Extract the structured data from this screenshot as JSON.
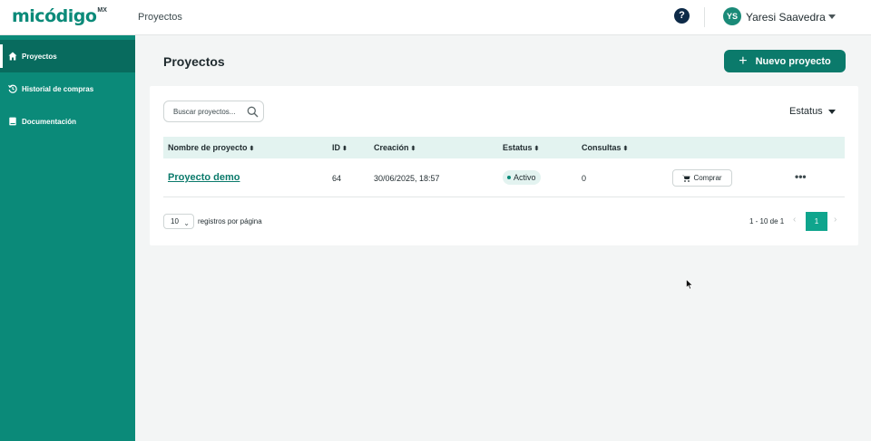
{
  "brand": {
    "logo_text": "micódigo",
    "logo_sup": "MX"
  },
  "header": {
    "breadcrumb": "Proyectos",
    "help_glyph": "?",
    "user_initials": "YS",
    "user_name": "Yaresi Saavedra"
  },
  "sidebar": {
    "items": [
      {
        "label": "Proyectos",
        "icon": "home-icon",
        "active": true
      },
      {
        "label": "Historial de compras",
        "icon": "history-icon",
        "active": false
      },
      {
        "label": "Documentación",
        "icon": "book-icon",
        "active": false
      }
    ]
  },
  "main": {
    "title": "Proyectos",
    "new_button_label": "Nuevo proyecto",
    "search_placeholder": "Buscar proyectos...",
    "status_filter_label": "Estatus"
  },
  "table": {
    "columns": [
      "Nombre de proyecto",
      "ID",
      "Creación",
      "Estatus",
      "Consultas"
    ],
    "rows": [
      {
        "name": "Proyecto demo",
        "id": "64",
        "created": "30/06/2025, 18:57",
        "status": "Activo",
        "queries": "0",
        "action_label": "Comprar"
      }
    ]
  },
  "pagination": {
    "per_page": "10",
    "per_page_label": "registros por página",
    "range": "1 - 10 de 1",
    "current_page": "1"
  },
  "colors": {
    "brand": "#0b8a79",
    "brand_dark": "#086b5e",
    "accent_button": "#0b7a6b",
    "header_row": "#e3f3f0",
    "page_active": "#0fa58d"
  }
}
